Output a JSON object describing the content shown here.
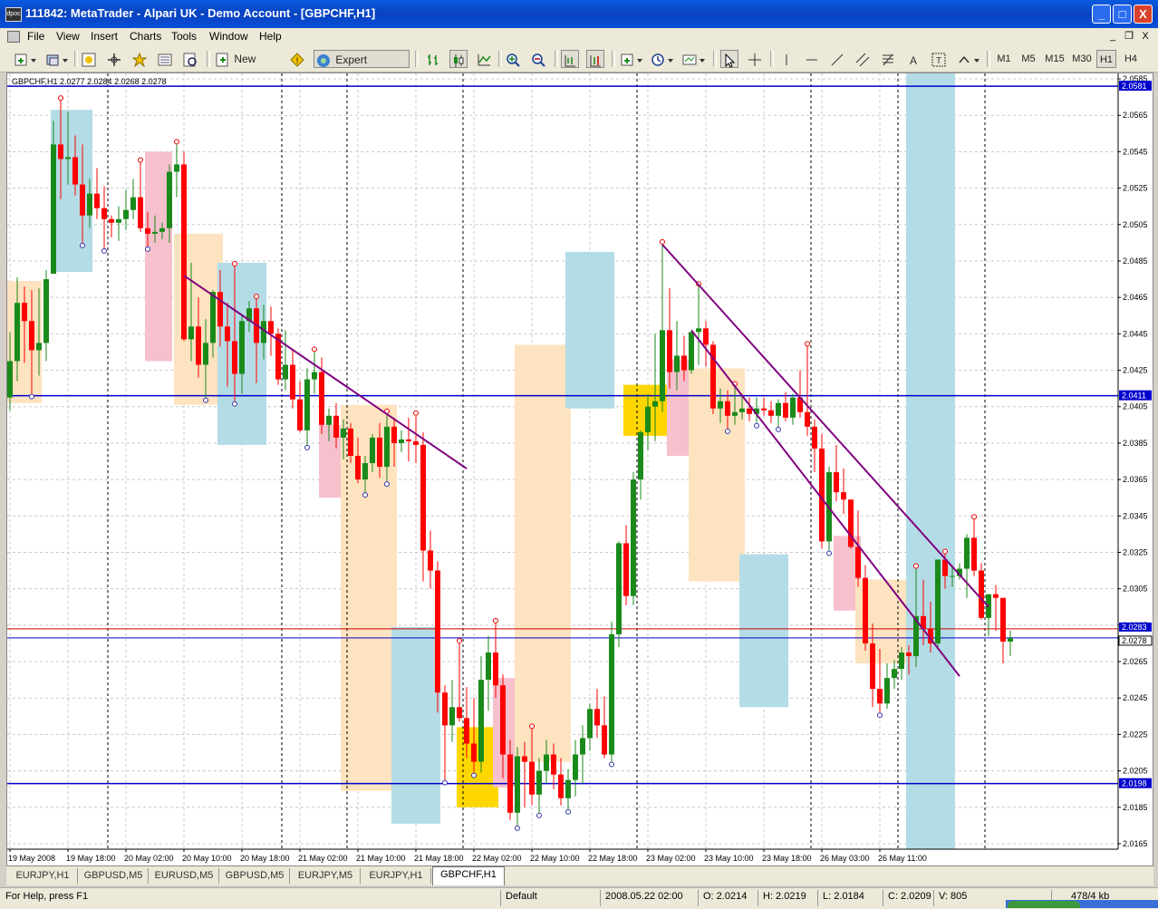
{
  "window": {
    "title": "111842: MetaTrader - Alpari UK - Demo Account - [GBPCHF,H1]",
    "app_icon_text": "dpoc",
    "buttons": [
      "_",
      "□",
      "X"
    ]
  },
  "menu": {
    "items": [
      "File",
      "View",
      "Insert",
      "Charts",
      "Tools",
      "Window",
      "Help"
    ],
    "mdi_buttons": [
      "_",
      "❐",
      "X"
    ]
  },
  "toolbar": {
    "new_order_label": "New Order",
    "expert_advisors_label": "Expert Advisors",
    "periods": [
      "M1",
      "M5",
      "M15",
      "M30",
      "H1",
      "H4"
    ],
    "active_period": "H1"
  },
  "chart": {
    "info_text": "GBPCHF,H1  2.0277 2.0284 2.0268 2.0278",
    "colors": {
      "bull": "#1a8a1a",
      "bear": "#ff0000",
      "hline": "#0000cc",
      "trend": "#800080",
      "bid": "#cc0000",
      "box_orange": "#fde3c0",
      "box_blue": "#b4dce6",
      "box_pink": "#f6c0cc",
      "box_yellow": "#ffd700"
    }
  },
  "chart_data": {
    "type": "candlestick",
    "title": "GBPCHF,H1  2.0277 2.0284 2.0268 2.0278",
    "symbol": "GBPCHF",
    "timeframe": "H1",
    "ylim": [
      2.0162,
      2.0588
    ],
    "y_ticks": [
      "2.0585",
      "2.0565",
      "2.0545",
      "2.0525",
      "2.0505",
      "2.0485",
      "2.0465",
      "2.0445",
      "2.0425",
      "2.0405",
      "2.0385",
      "2.0365",
      "2.0345",
      "2.0325",
      "2.0305",
      "2.0285",
      "2.0265",
      "2.0245",
      "2.0225",
      "2.0205",
      "2.0185",
      "2.0165"
    ],
    "x_ticks": [
      "19 May 2008",
      "19 May 18:00",
      "20 May 02:00",
      "20 May 10:00",
      "20 May 18:00",
      "21 May 02:00",
      "21 May 10:00",
      "21 May 18:00",
      "22 May 02:00",
      "22 May 10:00",
      "22 May 18:00",
      "23 May 02:00",
      "23 May 10:00",
      "23 May 18:00",
      "26 May 03:00",
      "26 May 11:00"
    ],
    "horizontal_lines": [
      {
        "price": 2.0581,
        "label": "2.0581"
      },
      {
        "price": 2.0411,
        "label": "2.0411"
      },
      {
        "price": 2.0198,
        "label": "2.0198"
      }
    ],
    "bid": {
      "price": 2.0283,
      "label": "2.0283"
    },
    "last": {
      "price": 2.0278,
      "label": "2.0278"
    },
    "candles": [
      [
        2.041,
        2.0446,
        2.0403,
        2.043
      ],
      [
        2.043,
        2.0476,
        2.0419,
        2.0462
      ],
      [
        2.0462,
        2.0471,
        2.0429,
        2.0452
      ],
      [
        2.0452,
        2.0469,
        2.0412,
        2.0436
      ],
      [
        2.0436,
        2.047,
        2.0422,
        2.044
      ],
      [
        2.044,
        2.048,
        2.043,
        2.0475
      ],
      [
        2.0478,
        2.0562,
        2.0478,
        2.0549
      ],
      [
        2.0549,
        2.0573,
        2.0519,
        2.0541
      ],
      [
        2.0541,
        2.0567,
        2.0527,
        2.0542
      ],
      [
        2.0542,
        2.0554,
        2.0521,
        2.0527
      ],
      [
        2.0527,
        2.0549,
        2.0495,
        2.051
      ],
      [
        2.051,
        2.053,
        2.0503,
        2.0522
      ],
      [
        2.0522,
        2.0536,
        2.0508,
        2.0514
      ],
      [
        2.0514,
        2.0526,
        2.0492,
        2.0508
      ],
      [
        2.0508,
        2.051,
        2.0498,
        2.0506
      ],
      [
        2.0506,
        2.0515,
        2.0496,
        2.0508
      ],
      [
        2.0508,
        2.0524,
        2.0502,
        2.0513
      ],
      [
        2.0513,
        2.053,
        2.0508,
        2.052
      ],
      [
        2.052,
        2.0539,
        2.0501,
        2.0503
      ],
      [
        2.0503,
        2.0512,
        2.0493,
        2.05
      ],
      [
        2.05,
        2.051,
        2.0495,
        2.0501
      ],
      [
        2.0501,
        2.0506,
        2.0497,
        2.0503
      ],
      [
        2.0503,
        2.0538,
        2.0495,
        2.0534
      ],
      [
        2.0534,
        2.0549,
        2.052,
        2.0538
      ],
      [
        2.0538,
        2.0545,
        2.0441,
        2.0442
      ],
      [
        2.0442,
        2.0484,
        2.043,
        2.0449
      ],
      [
        2.0449,
        2.0465,
        2.0421,
        2.0428
      ],
      [
        2.0428,
        2.0453,
        2.041,
        2.044
      ],
      [
        2.044,
        2.0469,
        2.0432,
        2.0468
      ],
      [
        2.0468,
        2.048,
        2.0438,
        2.0449
      ],
      [
        2.0449,
        2.0462,
        2.0416,
        2.0441
      ],
      [
        2.0441,
        2.0482,
        2.0408,
        2.0423
      ],
      [
        2.0423,
        2.0455,
        2.0412,
        2.0452
      ],
      [
        2.0452,
        2.0463,
        2.0446,
        2.0459
      ],
      [
        2.0459,
        2.0464,
        2.0418,
        2.044
      ],
      [
        2.044,
        2.0461,
        2.0431,
        2.0452
      ],
      [
        2.0452,
        2.046,
        2.0433,
        2.0445
      ],
      [
        2.0445,
        2.0448,
        2.0417,
        2.042
      ],
      [
        2.042,
        2.0447,
        2.0414,
        2.0428
      ],
      [
        2.0428,
        2.0436,
        2.0404,
        2.0409
      ],
      [
        2.0409,
        2.0419,
        2.0391,
        2.0392
      ],
      [
        2.0392,
        2.0426,
        2.0384,
        2.042
      ],
      [
        2.042,
        2.0435,
        2.0412,
        2.0424
      ],
      [
        2.0424,
        2.0432,
        2.039,
        2.0395
      ],
      [
        2.0395,
        2.0404,
        2.0386,
        2.04
      ],
      [
        2.04,
        2.0407,
        2.0382,
        2.0388
      ],
      [
        2.0388,
        2.0398,
        2.0376,
        2.0393
      ],
      [
        2.0393,
        2.0396,
        2.0374,
        2.0378
      ],
      [
        2.0378,
        2.0388,
        2.0363,
        2.0365
      ],
      [
        2.0365,
        2.0378,
        2.0358,
        2.0374
      ],
      [
        2.0374,
        2.039,
        2.0369,
        2.0388
      ],
      [
        2.0388,
        2.0396,
        2.0366,
        2.0372
      ],
      [
        2.0372,
        2.0401,
        2.0364,
        2.0394
      ],
      [
        2.0394,
        2.0399,
        2.0372,
        2.0385
      ],
      [
        2.0385,
        2.0392,
        2.038,
        2.0387
      ],
      [
        2.0387,
        2.0399,
        2.0375,
        2.0386
      ],
      [
        2.0386,
        2.04,
        2.0374,
        2.0384
      ],
      [
        2.0384,
        2.0391,
        2.0309,
        2.0326
      ],
      [
        2.0326,
        2.0337,
        2.0305,
        2.0315
      ],
      [
        2.0315,
        2.032,
        2.0237,
        2.0248
      ],
      [
        2.0248,
        2.0252,
        2.02,
        2.023
      ],
      [
        2.023,
        2.0255,
        2.0221,
        2.024
      ],
      [
        2.024,
        2.0275,
        2.0232,
        2.0234
      ],
      [
        2.0234,
        2.0251,
        2.0212,
        2.022
      ],
      [
        2.022,
        2.0245,
        2.0204,
        2.021
      ],
      [
        2.021,
        2.0268,
        2.0204,
        2.0255
      ],
      [
        2.0255,
        2.0279,
        2.0238,
        2.027
      ],
      [
        2.027,
        2.0286,
        2.0245,
        2.0252
      ],
      [
        2.0252,
        2.0258,
        2.0201,
        2.0214
      ],
      [
        2.0214,
        2.0222,
        2.0178,
        2.0182
      ],
      [
        2.0182,
        2.0218,
        2.0175,
        2.0213
      ],
      [
        2.0213,
        2.0221,
        2.0185,
        2.021
      ],
      [
        2.021,
        2.0228,
        2.0186,
        2.0192
      ],
      [
        2.0192,
        2.0212,
        2.0182,
        2.0205
      ],
      [
        2.0205,
        2.0222,
        2.0198,
        2.0214
      ],
      [
        2.0214,
        2.022,
        2.0195,
        2.0203
      ],
      [
        2.0203,
        2.0212,
        2.0186,
        2.019
      ],
      [
        2.019,
        2.0206,
        2.0184,
        2.02
      ],
      [
        2.02,
        2.0222,
        2.0191,
        2.0214
      ],
      [
        2.0214,
        2.023,
        2.0198,
        2.0223
      ],
      [
        2.0223,
        2.0242,
        2.0216,
        2.0239
      ],
      [
        2.0239,
        2.025,
        2.0223,
        2.023
      ],
      [
        2.023,
        2.0246,
        2.0212,
        2.0214
      ],
      [
        2.0214,
        2.0287,
        2.021,
        2.028
      ],
      [
        2.028,
        2.0331,
        2.0273,
        2.033
      ],
      [
        2.033,
        2.034,
        2.0296,
        2.0301
      ],
      [
        2.0301,
        2.0369,
        2.0296,
        2.0365
      ],
      [
        2.0365,
        2.0392,
        2.0354,
        2.0391
      ],
      [
        2.0391,
        2.0412,
        2.0381,
        2.0405
      ],
      [
        2.0405,
        2.0445,
        2.0386,
        2.0408
      ],
      [
        2.0408,
        2.0494,
        2.0402,
        2.0447
      ],
      [
        2.0447,
        2.047,
        2.0415,
        2.0424
      ],
      [
        2.0424,
        2.0452,
        2.0414,
        2.0433
      ],
      [
        2.0433,
        2.0444,
        2.0419,
        2.0425
      ],
      [
        2.0425,
        2.0446,
        2.0423,
        2.0446
      ],
      [
        2.0446,
        2.0471,
        2.0428,
        2.0448
      ],
      [
        2.0448,
        2.0452,
        2.0427,
        2.0439
      ],
      [
        2.0439,
        2.0441,
        2.0401,
        2.0404
      ],
      [
        2.0404,
        2.0415,
        2.0396,
        2.0408
      ],
      [
        2.0408,
        2.0414,
        2.0393,
        2.04
      ],
      [
        2.04,
        2.0416,
        2.0395,
        2.0402
      ],
      [
        2.0402,
        2.0412,
        2.0398,
        2.0404
      ],
      [
        2.0404,
        2.041,
        2.0397,
        2.0401
      ],
      [
        2.0401,
        2.041,
        2.0396,
        2.0404
      ],
      [
        2.0404,
        2.041,
        2.04,
        2.0403
      ],
      [
        2.0403,
        2.0408,
        2.0396,
        2.04
      ],
      [
        2.04,
        2.0409,
        2.0394,
        2.0407
      ],
      [
        2.0407,
        2.0413,
        2.0397,
        2.0399
      ],
      [
        2.0399,
        2.0412,
        2.0395,
        2.041
      ],
      [
        2.041,
        2.0425,
        2.0399,
        2.0402
      ],
      [
        2.0402,
        2.0438,
        2.0389,
        2.0394
      ],
      [
        2.0394,
        2.0398,
        2.0369,
        2.0382
      ],
      [
        2.0382,
        2.039,
        2.0327,
        2.0331
      ],
      [
        2.0331,
        2.0372,
        2.0326,
        2.0369
      ],
      [
        2.0369,
        2.0384,
        2.0353,
        2.0358
      ],
      [
        2.0358,
        2.0371,
        2.0346,
        2.0354
      ],
      [
        2.0354,
        2.0353,
        2.0327,
        2.0328
      ],
      [
        2.0328,
        2.0348,
        2.0306,
        2.0311
      ],
      [
        2.0311,
        2.0318,
        2.0271,
        2.0275
      ],
      [
        2.0275,
        2.0286,
        2.024,
        2.025
      ],
      [
        2.025,
        2.0272,
        2.0237,
        2.0242
      ],
      [
        2.0242,
        2.0264,
        2.0239,
        2.0256
      ],
      [
        2.0256,
        2.0266,
        2.025,
        2.0261
      ],
      [
        2.0261,
        2.0273,
        2.0255,
        2.027
      ],
      [
        2.027,
        2.0274,
        2.0258,
        2.0268
      ],
      [
        2.0268,
        2.0316,
        2.0262,
        2.029
      ],
      [
        2.029,
        2.031,
        2.0274,
        2.0283
      ],
      [
        2.0283,
        2.0298,
        2.027,
        2.0275
      ],
      [
        2.0275,
        2.032,
        2.0273,
        2.0321
      ],
      [
        2.0321,
        2.0324,
        2.0305,
        2.0312
      ],
      [
        2.0312,
        2.0318,
        2.0306,
        2.0312
      ],
      [
        2.0312,
        2.0319,
        2.031,
        2.0316
      ],
      [
        2.0316,
        2.0335,
        2.03,
        2.0333
      ],
      [
        2.0333,
        2.0343,
        2.0312,
        2.0315
      ],
      [
        2.0315,
        2.0319,
        2.0288,
        2.0289
      ],
      [
        2.0289,
        2.0301,
        2.0279,
        2.0302
      ],
      [
        2.0302,
        2.0307,
        2.0282,
        2.03
      ],
      [
        2.03,
        2.03,
        2.0264,
        2.0276
      ],
      [
        2.0276,
        2.0282,
        2.0268,
        2.0278
      ]
    ],
    "trend_lines": [
      {
        "t1": 24,
        "p1": 2.0477,
        "t2": 63,
        "p2": 2.0371
      },
      {
        "t1": 90,
        "p1": 2.0494,
        "t2": 135,
        "p2": 2.0295
      },
      {
        "t1": 94,
        "p1": 2.0447,
        "t2": 131,
        "p2": 2.0257
      }
    ],
    "zones": [
      {
        "t1": -2,
        "t2": 4,
        "top": 2.0474,
        "bottom": 2.0407,
        "color": "orange"
      },
      {
        "t1": 6,
        "t2": 11,
        "top": 2.0568,
        "bottom": 2.0479,
        "color": "blue"
      },
      {
        "t1": 19,
        "t2": 22,
        "top": 2.0545,
        "bottom": 2.043,
        "color": "pink"
      },
      {
        "t1": 23,
        "t2": 29,
        "top": 2.05,
        "bottom": 2.0406,
        "color": "orange"
      },
      {
        "t1": 29,
        "t2": 35,
        "top": 2.0484,
        "bottom": 2.0384,
        "color": "blue"
      },
      {
        "t1": 43,
        "t2": 46,
        "top": 2.0395,
        "bottom": 2.0355,
        "color": "pink"
      },
      {
        "t1": 46,
        "t2": 53,
        "top": 2.0406,
        "bottom": 2.0194,
        "color": "orange"
      },
      {
        "t1": 53,
        "t2": 59,
        "top": 2.0284,
        "bottom": 2.0176,
        "color": "blue"
      },
      {
        "t1": 62,
        "t2": 67,
        "top": 2.0229,
        "bottom": 2.0185,
        "color": "yellow"
      },
      {
        "t1": 67,
        "t2": 70,
        "top": 2.0256,
        "bottom": 2.0196,
        "color": "pink"
      },
      {
        "t1": 70,
        "t2": 77,
        "top": 2.0439,
        "bottom": 2.021,
        "color": "orange"
      },
      {
        "t1": 77,
        "t2": 83,
        "top": 2.049,
        "bottom": 2.0404,
        "color": "blue"
      },
      {
        "t1": 85,
        "t2": 93,
        "top": 2.0417,
        "bottom": 2.0389,
        "color": "yellow"
      },
      {
        "t1": 91,
        "t2": 94,
        "top": 2.0431,
        "bottom": 2.0378,
        "color": "pink"
      },
      {
        "t1": 94,
        "t2": 101,
        "top": 2.0426,
        "bottom": 2.0309,
        "color": "orange"
      },
      {
        "t1": 101,
        "t2": 107,
        "top": 2.0324,
        "bottom": 2.024,
        "color": "blue"
      },
      {
        "t1": 114,
        "t2": 117,
        "top": 2.0334,
        "bottom": 2.0293,
        "color": "pink"
      },
      {
        "t1": 117,
        "t2": 124,
        "top": 2.031,
        "bottom": 2.0264,
        "color": "orange"
      },
      {
        "t1": 124,
        "t2": 130,
        "top": 2.0588,
        "bottom": 2.0162,
        "color": "blue"
      }
    ]
  },
  "tabs": {
    "items": [
      "EURJPY,H1",
      "GBPUSD,M5",
      "EURUSD,M5",
      "GBPUSD,M5",
      "EURJPY,M5",
      "EURJPY,H1",
      "GBPCHF,H1"
    ],
    "active": 6
  },
  "status": {
    "help": "For Help, press F1",
    "profile": "Default",
    "time": "2008.05.22 02:00",
    "open": "O: 2.0214",
    "high": "H: 2.0219",
    "low": "L: 2.0184",
    "close": "C: 2.0209",
    "volume": "V: 805",
    "traffic": "478/4 kb"
  }
}
